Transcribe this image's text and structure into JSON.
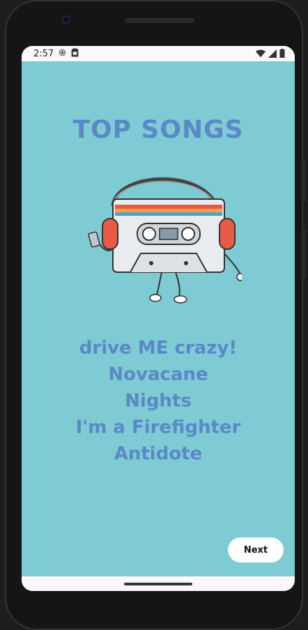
{
  "status_bar": {
    "time": "2:57",
    "icons": [
      "settings-icon",
      "sim-card-icon",
      "wifi-icon",
      "signal-icon",
      "battery-icon"
    ]
  },
  "screen": {
    "title": "TOP SONGS",
    "illustration": "cassette-with-headphones",
    "songs": [
      "drive ME crazy!",
      "Novacane",
      "Nights",
      "I'm a Firefighter",
      "Antidote"
    ],
    "next_label": "Next"
  },
  "colors": {
    "background": "#7ecbd3",
    "text": "#5b88c7",
    "button": "#ffffff"
  }
}
